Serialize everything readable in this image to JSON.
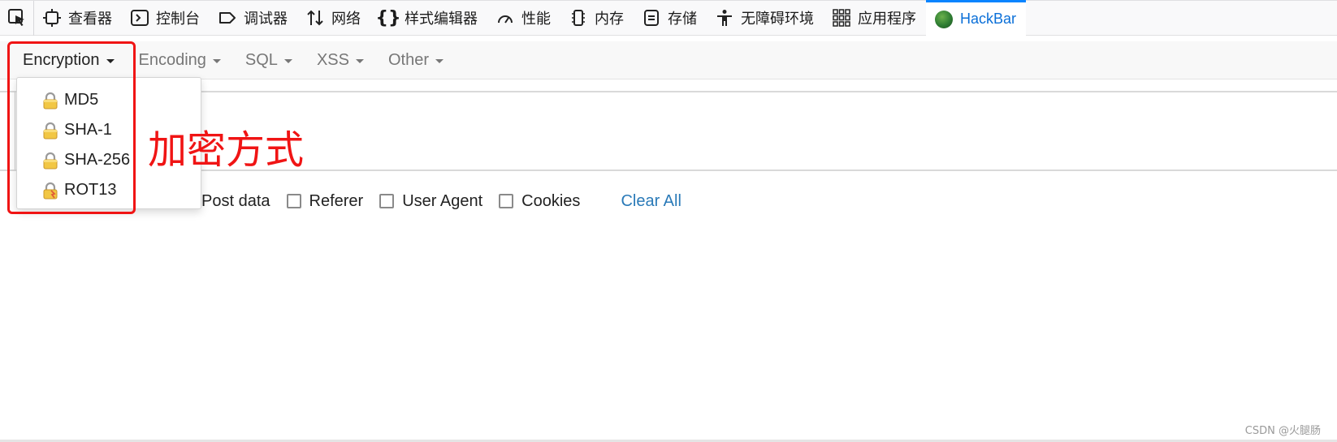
{
  "devtools": {
    "tabs": [
      {
        "label": "查看器",
        "icon": "inspector-icon"
      },
      {
        "label": "控制台",
        "icon": "console-icon"
      },
      {
        "label": "调试器",
        "icon": "debugger-icon"
      },
      {
        "label": "网络",
        "icon": "network-icon"
      },
      {
        "label": "样式编辑器",
        "icon": "style-editor-icon"
      },
      {
        "label": "性能",
        "icon": "performance-icon"
      },
      {
        "label": "内存",
        "icon": "memory-icon"
      },
      {
        "label": "存储",
        "icon": "storage-icon"
      },
      {
        "label": "无障碍环境",
        "icon": "accessibility-icon"
      },
      {
        "label": "应用程序",
        "icon": "application-icon"
      },
      {
        "label": "HackBar",
        "icon": "hackbar-logo-icon",
        "active": true
      }
    ],
    "accent_color": "#0a84ff"
  },
  "hackbar": {
    "menu": [
      {
        "label": "Encryption",
        "open": true
      },
      {
        "label": "Encoding"
      },
      {
        "label": "SQL"
      },
      {
        "label": "XSS"
      },
      {
        "label": "Other"
      }
    ],
    "dropdown": [
      {
        "label": "MD5",
        "icon": "lock-icon"
      },
      {
        "label": "SHA-1",
        "icon": "lock-icon"
      },
      {
        "label": "SHA-256",
        "icon": "lock-icon"
      },
      {
        "label": "ROT13",
        "icon": "lock-broken-icon"
      }
    ],
    "options": [
      {
        "label": "Post data",
        "checked": false
      },
      {
        "label": "Referer",
        "checked": false
      },
      {
        "label": "User Agent",
        "checked": false
      },
      {
        "label": "Cookies",
        "checked": false
      }
    ],
    "clear_all": "Clear All"
  },
  "annotation": {
    "text": "加密方式",
    "color": "#f01414"
  },
  "watermark": "CSDN @火腿肠"
}
